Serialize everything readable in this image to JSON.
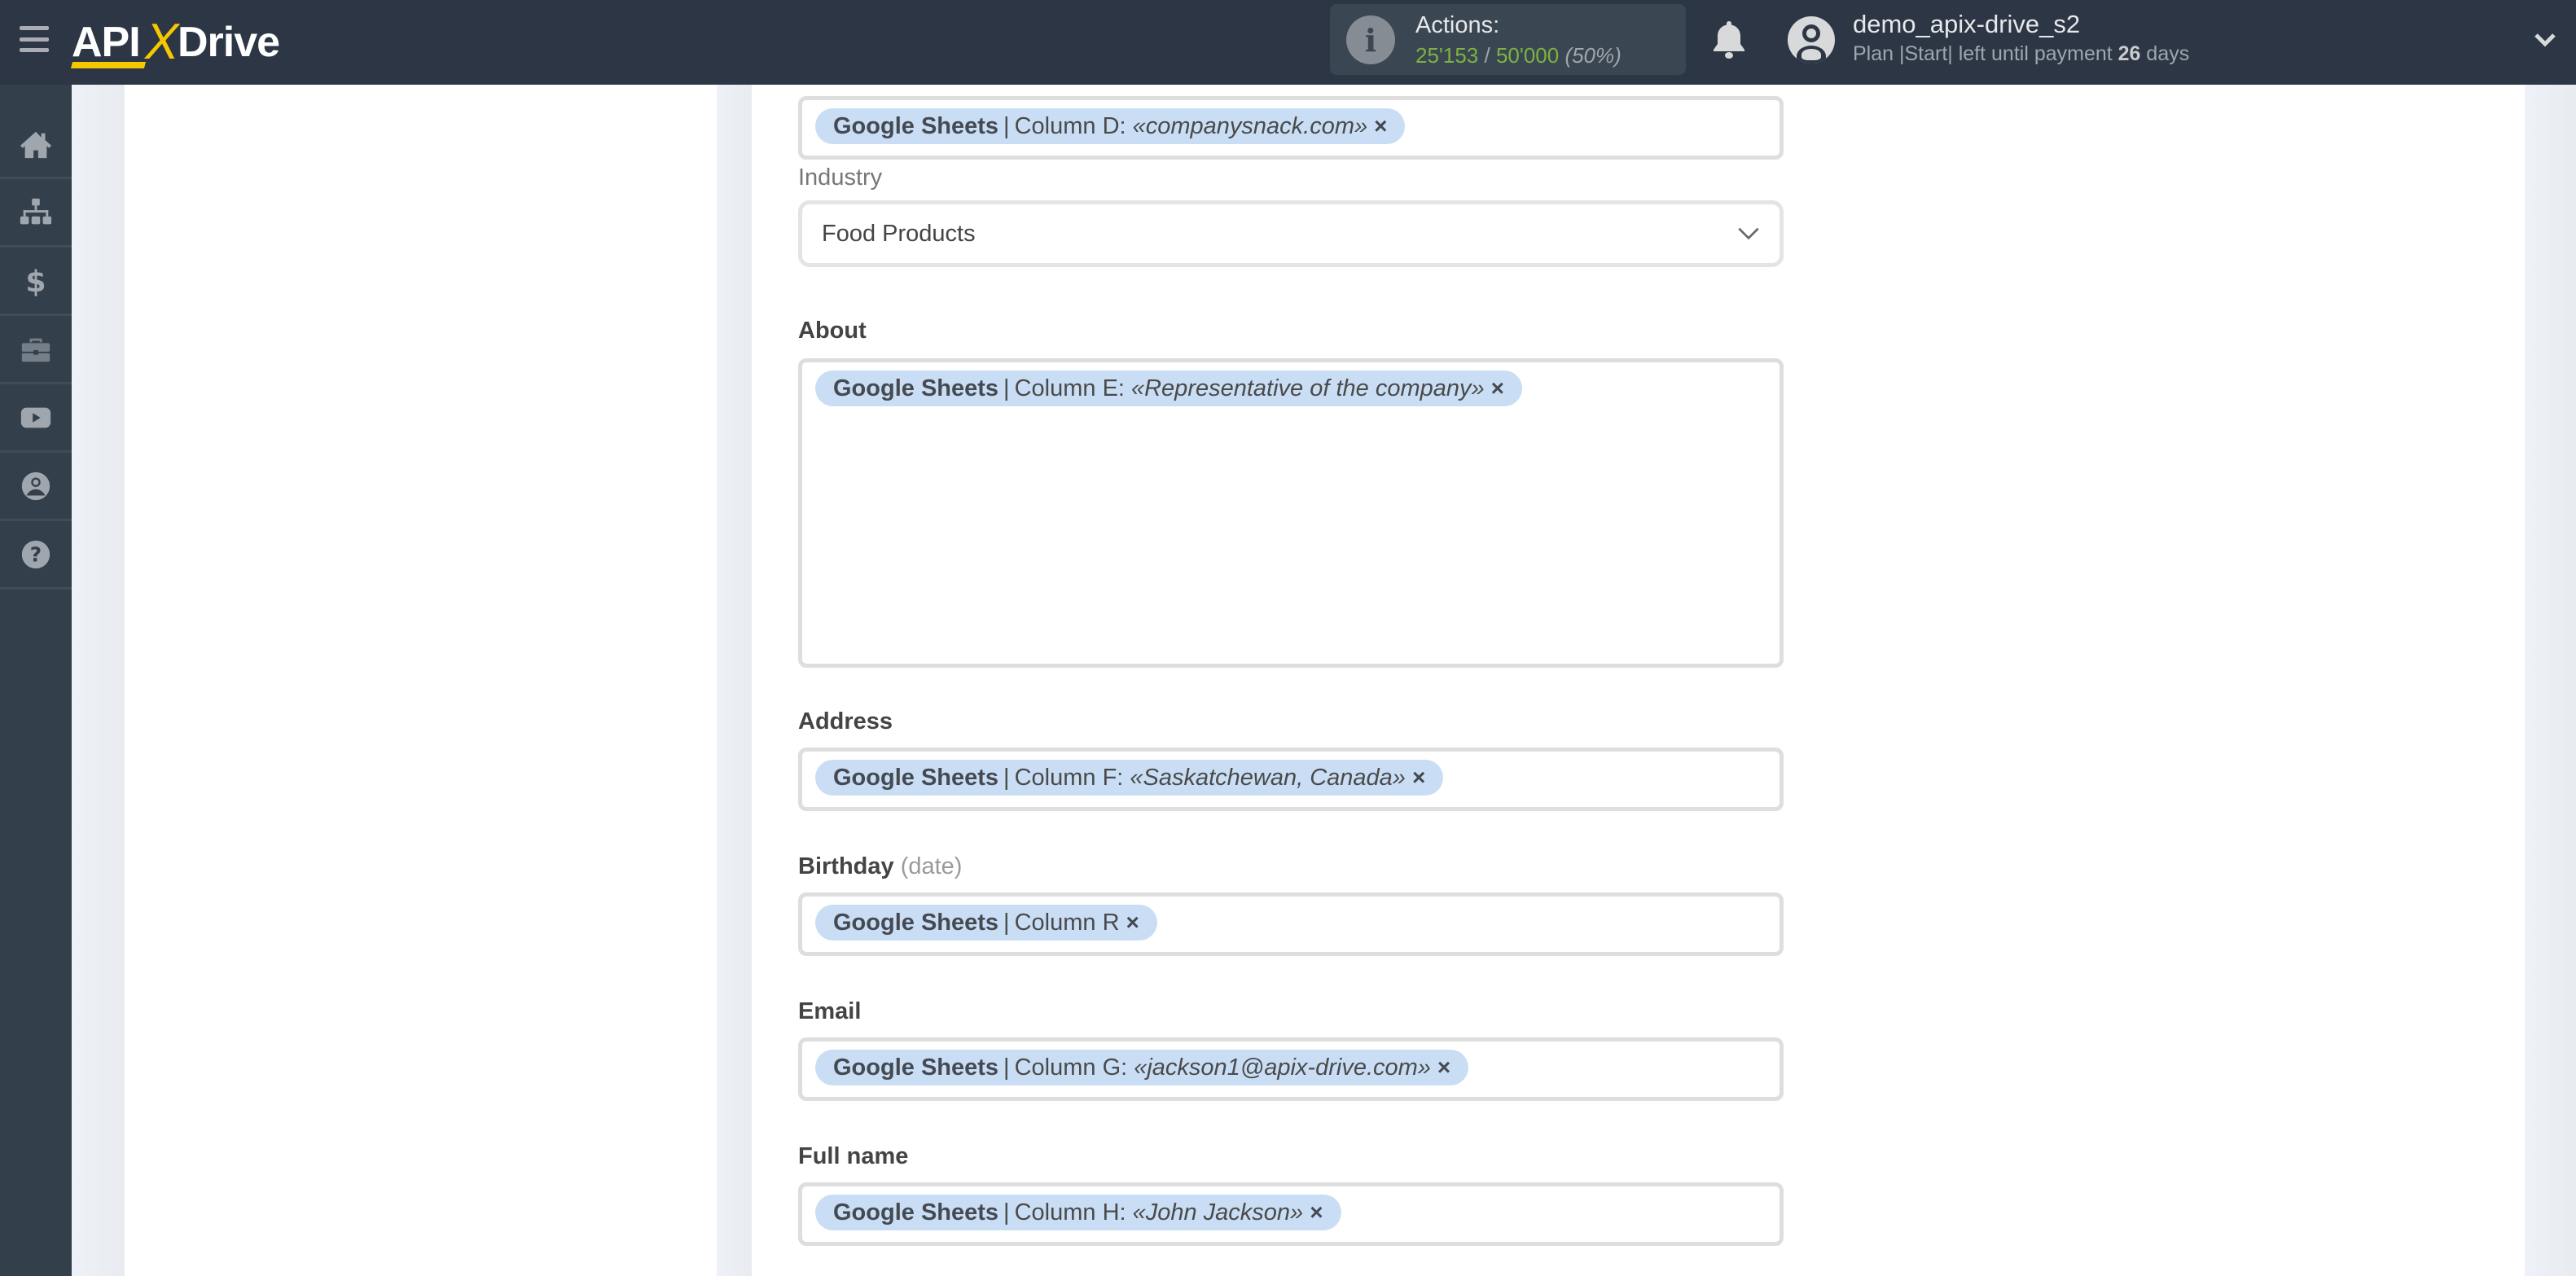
{
  "header": {
    "logo": {
      "api": "API",
      "x": "X",
      "drive": "Drive"
    },
    "actions": {
      "label": "Actions:",
      "used": "25'153",
      "separator": " / ",
      "total": "50'000",
      "percent": "(50%)"
    },
    "user": {
      "name": "demo_apix-drive_s2",
      "plan_prefix": "Plan |Start| left until payment ",
      "days": "26",
      "days_suffix": " days"
    }
  },
  "sidebar": {
    "items": [
      {
        "name": "home",
        "icon": "home-icon"
      },
      {
        "name": "connections",
        "icon": "sitemap-icon"
      },
      {
        "name": "billing",
        "icon": "dollar-icon"
      },
      {
        "name": "tools",
        "icon": "briefcase-icon"
      },
      {
        "name": "videos",
        "icon": "youtube-icon"
      },
      {
        "name": "account",
        "icon": "user-circle-icon"
      },
      {
        "name": "help",
        "icon": "question-circle-icon"
      }
    ]
  },
  "form": {
    "website": {
      "tag": {
        "source": "Google Sheets",
        "column": "Column D:",
        "value": "«companysnack.com»"
      }
    },
    "industry": {
      "label": "Industry",
      "selected": "Food Products"
    },
    "about": {
      "label": "About",
      "tag": {
        "source": "Google Sheets",
        "column": "Column E:",
        "value": "«Representative of the company»"
      }
    },
    "address": {
      "label": "Address",
      "tag": {
        "source": "Google Sheets",
        "column": "Column F:",
        "value": "«Saskatchewan, Canada»"
      }
    },
    "birthday": {
      "label": "Birthday",
      "hint": "(date)",
      "tag": {
        "source": "Google Sheets",
        "column": "Column R",
        "value": ""
      }
    },
    "email": {
      "label": "Email",
      "tag": {
        "source": "Google Sheets",
        "column": "Column G:",
        "value": "«jackson1@apix-drive.com»"
      }
    },
    "full_name": {
      "label": "Full name",
      "tag": {
        "source": "Google Sheets",
        "column": "Column H:",
        "value": "«John Jackson»"
      }
    },
    "tag_separator": "|",
    "remove_glyph": "×"
  },
  "colors": {
    "header_bg": "#2c3644",
    "sidebar_bg": "#343f4c",
    "accent_yellow": "#f5c800",
    "actions_green": "#7cb342",
    "tag_bg": "#c9def5"
  }
}
